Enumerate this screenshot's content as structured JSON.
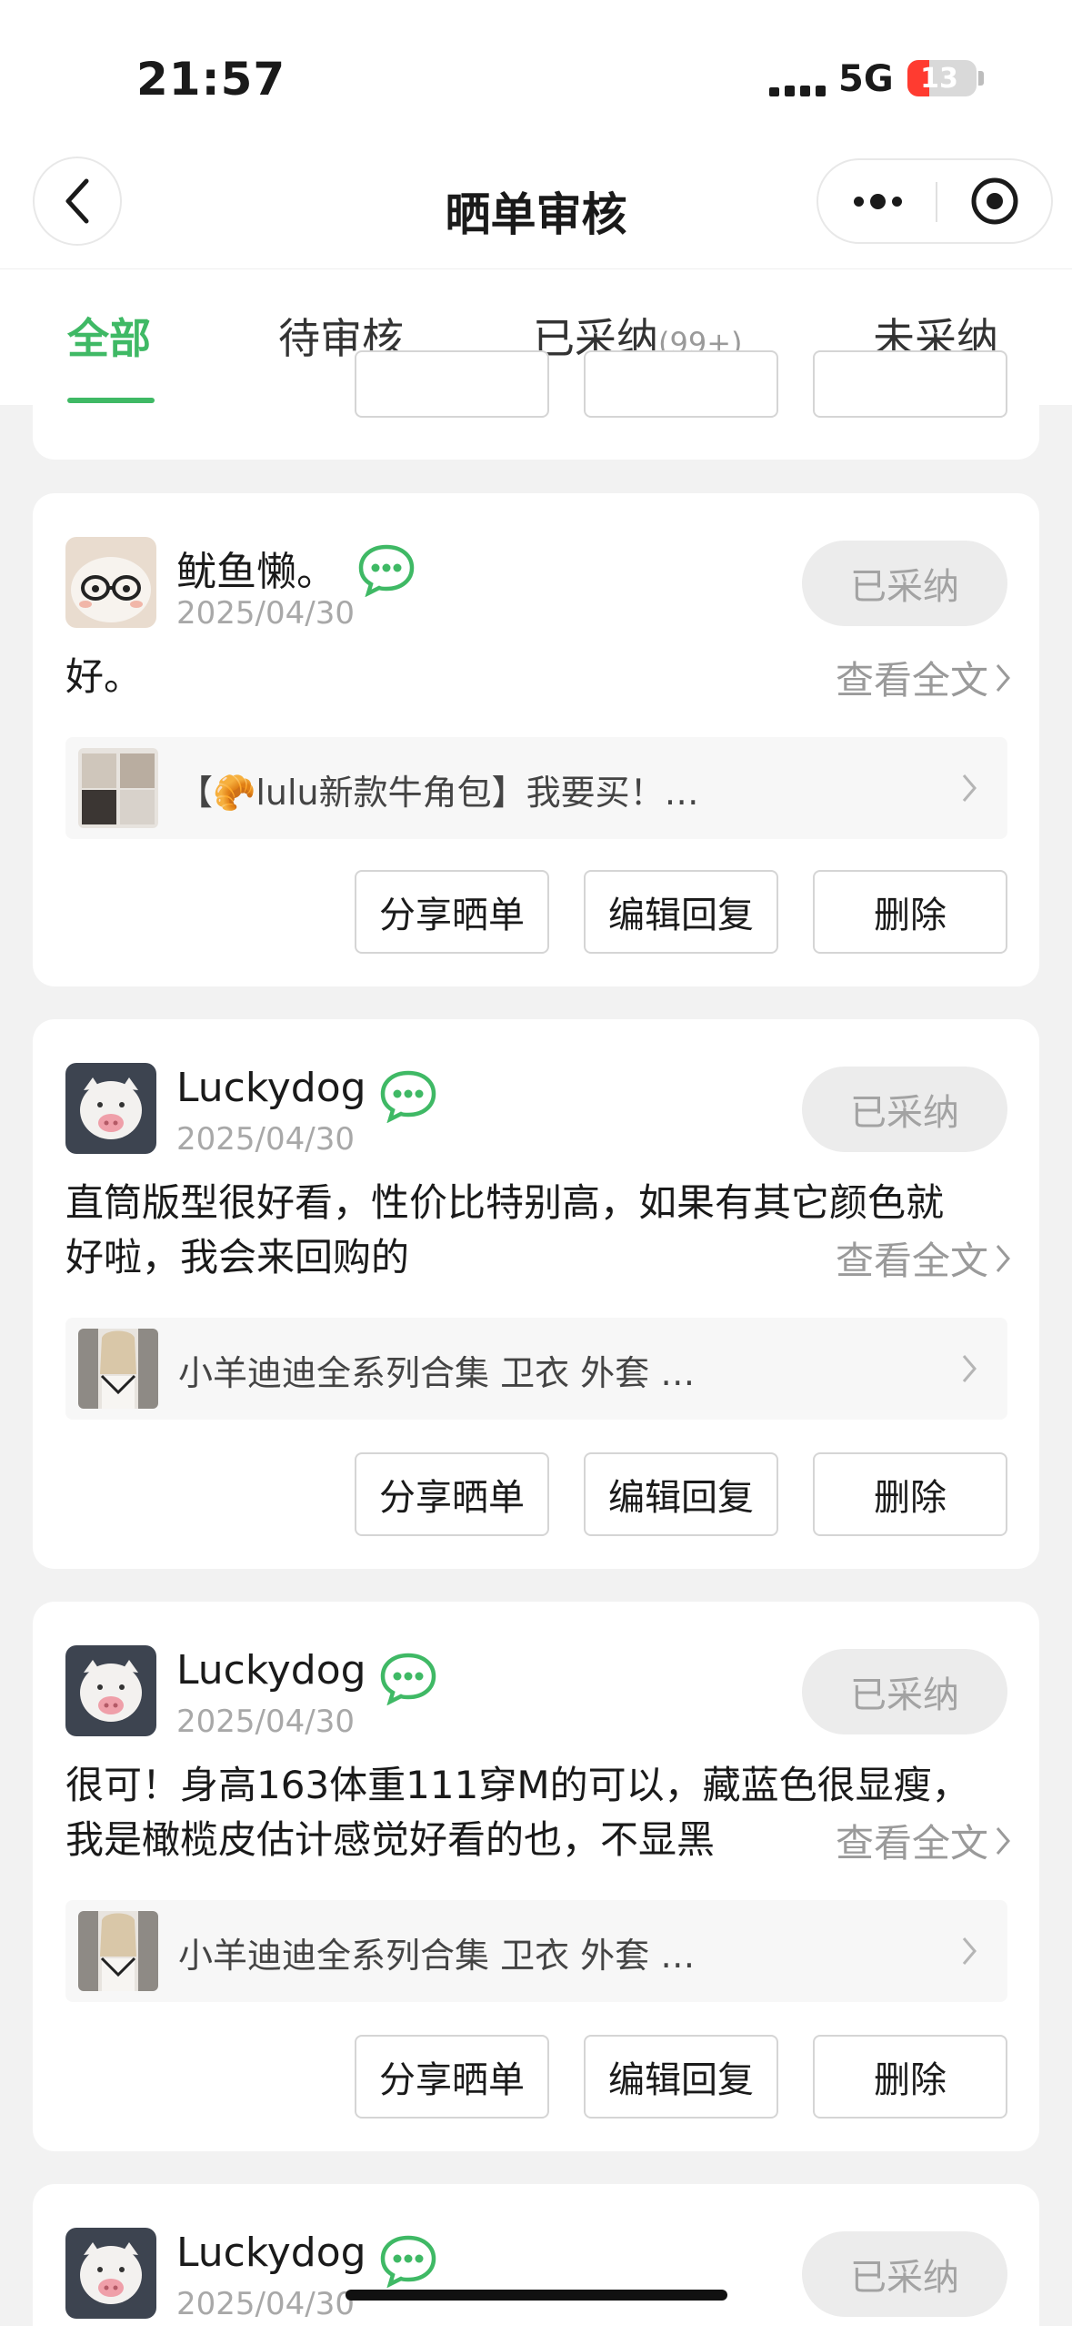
{
  "status_bar": {
    "time": "21:57",
    "network": "5G",
    "battery": "13"
  },
  "nav": {
    "title": "晒单审核",
    "icons": {
      "back": "chevron-left-icon",
      "more": "more-dots-icon",
      "close": "target-circle-icon"
    }
  },
  "tabs": [
    {
      "label": "全部",
      "active": true
    },
    {
      "label": "待审核"
    },
    {
      "label": "已采纳",
      "count": "(99+)"
    },
    {
      "label": "未采纳"
    }
  ],
  "actions": {
    "share": "分享晒单",
    "edit_reply": "编辑回复",
    "delete": "删除"
  },
  "reviews": [
    {
      "username": "鱿鱼懒。",
      "date": "2025/04/30",
      "status": "已采纳",
      "content": "好。",
      "read_all": "查看全文",
      "product_prefix": "【",
      "product_emoji": "🥐",
      "product_title": "lulu新款牛角包】我要买！…"
    },
    {
      "username": "Luckydog",
      "date": "2025/04/30",
      "status": "已采纳",
      "content_line1": "直筒版型很好看，性价比特别高，如果有其它颜色就",
      "content_line2": "好啦，我会来回购的",
      "read_all": "查看全文",
      "product_title": "小羊迪迪全系列合集 卫衣 外套 …"
    },
    {
      "username": "Luckydog",
      "date": "2025/04/30",
      "status": "已采纳",
      "content_line1": "很可！身高163体重111穿M的可以，藏蓝色很显瘦，",
      "content_line2": "我是橄榄皮估计感觉好看的也，不显黑",
      "read_all": "查看全文",
      "product_title": "小羊迪迪全系列合集 卫衣 外套 …"
    },
    {
      "username": "Luckydog",
      "date": "2025/04/30",
      "status": "已采纳"
    }
  ],
  "colors": {
    "accent": "#3fb965",
    "muted": "#a3a3a3",
    "background": "#f2f2f2"
  }
}
